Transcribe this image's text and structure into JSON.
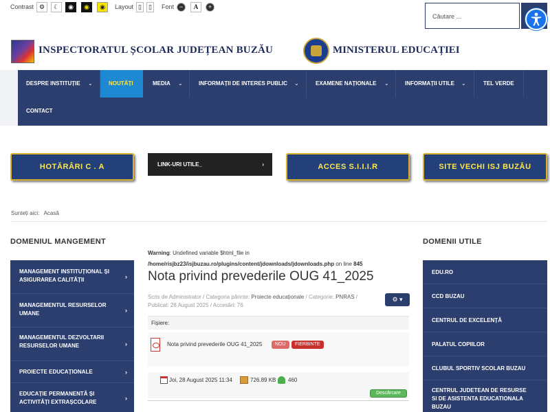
{
  "a11y": {
    "contrast_label": "Contrast",
    "layout_label": "Layout",
    "font_label": "Font",
    "font_decrease": "−",
    "font_reset": "A",
    "font_increase": "+"
  },
  "search": {
    "placeholder": "Căutare ..."
  },
  "header": {
    "left_title": "INSPECTORATUL ȘCOLAR JUDEȚEAN BUZĂU",
    "right_title": "MINISTERUL EDUCAȚIEI"
  },
  "nav": {
    "items": [
      {
        "label": "DESPRE INSTITUȚIE",
        "has_dropdown": true
      },
      {
        "label": "NOUTĂȚI",
        "active": true
      },
      {
        "label": "MEDIA",
        "has_dropdown": true
      },
      {
        "label": "INFORMAȚII DE INTERES PUBLIC",
        "has_dropdown": true
      },
      {
        "label": "EXAMENE NAȚIONALE",
        "has_dropdown": true
      },
      {
        "label": "INFORMAȚII UTILE",
        "has_dropdown": true
      },
      {
        "label": "TEL VERDE"
      },
      {
        "label": "CONTACT"
      }
    ],
    "chevron": "⌄"
  },
  "banners": {
    "hotarari": "HOTĂRÂRI  C . A",
    "links": "LINK-URI UTILE_",
    "links_chevron": "›",
    "acces": "ACCES  S.I.I.I.R",
    "site_vechi": "SITE VECHI ISJ BUZĂU"
  },
  "breadcrumb": {
    "prefix": "Sunteți aici:",
    "current": "Acasă"
  },
  "left_sidebar": {
    "title": "DOMENIUL MANGEMENT",
    "items": [
      "MANAGEMENT INSTITUȚIONAL ȘI ASIGURAREA CALITĂȚII",
      "MANAGEMENTUL RESURSELOR UMANE",
      "MANAGEMENTUL DEZVOLTARII RESURSELOR UMANE",
      "PROIECTE EDUCAȚIONALE",
      "EDUCAȚIE PERMANENTĂ ȘI ACTIVITĂȚI EXTRAȘCOLARE"
    ],
    "chevron": "›"
  },
  "right_sidebar": {
    "title": "DOMENII UTILE",
    "items": [
      "EDU.RO",
      "CCD BUZAU",
      "CENTRUL DE EXCELENȚĂ",
      "PALATUL COPIILOR",
      "CLUBUL SPORTIV SCOLAR BUZAU",
      "CENTRUL JUDETEAN DE RESURSE SI DE ASISTENTA EDUCATIONALA BUZAU"
    ]
  },
  "main": {
    "warning_label": "Warning",
    "warning_text": ": Undefined variable $html_file in",
    "warning_path": "/home/risjbz23/isjbuzau.ro/plugins/content/jdownloads/jdownloads.php",
    "warning_line_prefix": " on line ",
    "warning_line": "845",
    "title": "Nota privind prevederile OUG 41_2025",
    "meta_author": "Scris de Administrator",
    "meta_parent_label": "Categoria părinte:",
    "meta_parent": "Proiecte educaționale",
    "meta_category_label": "Categorie:",
    "meta_category": "PNRAS",
    "meta_published": "Publicat: 28 August 2025",
    "meta_hits": "Accesări: 76",
    "files_label": "Fișiere:",
    "file_name": "Nota privind prevederile OUG 41_2025",
    "badge_new": "NOU",
    "badge_hot": "FIERBINTE",
    "file_date": "Joi, 28 August 2025 11:34",
    "file_size": "726.89 KB",
    "file_downloads": "460",
    "download_label": "Descărcare"
  }
}
